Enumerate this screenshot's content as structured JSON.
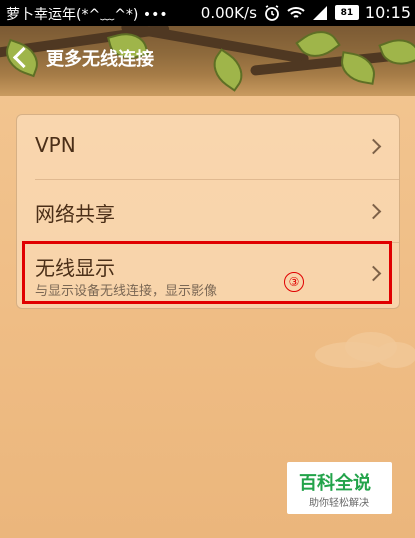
{
  "status_bar": {
    "carrier": "萝卜幸运年(*^﹏^*) •••",
    "network_speed": "0.00K/s",
    "battery_level": "81",
    "time": "10:15"
  },
  "header": {
    "title": "更多无线连接"
  },
  "settings": {
    "items": [
      {
        "label": "VPN"
      },
      {
        "label": "网络共享"
      },
      {
        "label": "无线显示",
        "subtitle": "与显示设备无线连接，显示影像"
      }
    ]
  },
  "annotation": {
    "marker": "③"
  },
  "watermark": {
    "title": "百科全说",
    "subtitle": "助你轻松解决"
  }
}
